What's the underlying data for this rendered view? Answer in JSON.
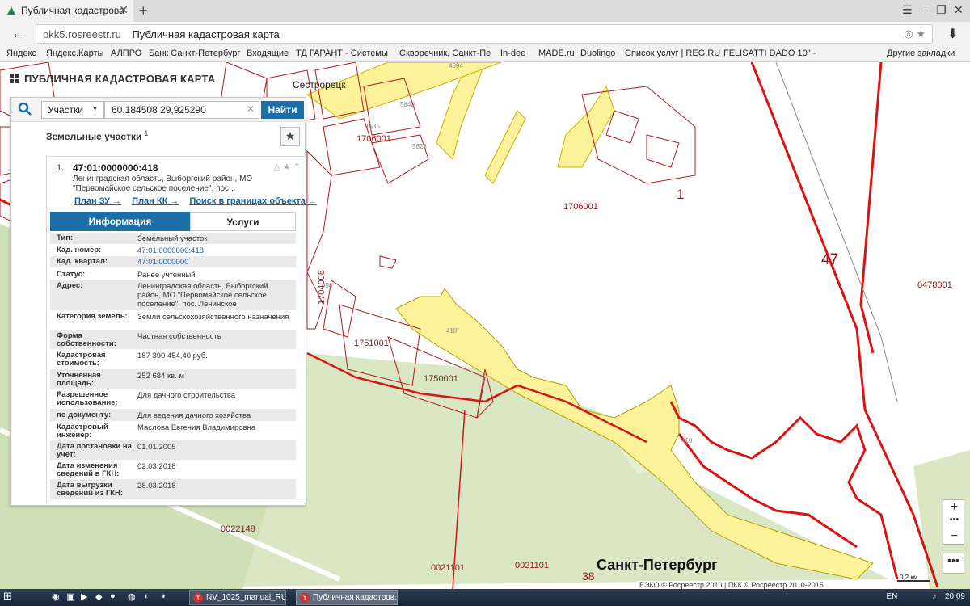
{
  "browser": {
    "tab_title": "Публичная кадастрова",
    "url_domain": "pkk5.rosreestr.ru",
    "page_title": "Публичная кадастровая карта",
    "bookmarks": [
      "Яндекс",
      "Яндекс.Карты",
      "АЛПРО",
      "Банк Санкт-Петербург",
      "Входящие",
      "ТД ГАРАНТ - Системы",
      "Скворечник, Санкт-Пе",
      "In-dee",
      "MADE.ru",
      "Duolingo",
      "Список услуг | REG.RU",
      "FELISATTI DADO 10\" -"
    ],
    "other_bookmarks": "Другие закладки"
  },
  "app": {
    "title": "ПУБЛИЧНАЯ КАДАСТРОВАЯ КАРТА"
  },
  "search": {
    "type": "Участки",
    "query": "60,184508 29,925290",
    "button": "Найти"
  },
  "results": {
    "header": "Земельные участки",
    "count": "1",
    "item_index": "1.",
    "cad_number": "47:01:0000000:418",
    "address_lines": [
      "Ленинградская область, Выборгский район, МО",
      "\"Первомайское сельское поселение\", пос..."
    ],
    "links": [
      "План ЗУ →",
      "План КК →",
      "Поиск в границах объекта →"
    ],
    "tab_info": "Информация",
    "tab_services": "Услуги",
    "rows": [
      {
        "k": "Тип:",
        "v": "Земельный участок"
      },
      {
        "k": "Кад. номер:",
        "v": "47:01:0000000:418"
      },
      {
        "k": "Кад. квартал:",
        "v": "47:01:0000000"
      },
      {
        "k": "Статус:",
        "v": "Ранее учтенный"
      },
      {
        "k": "Адрес:",
        "v": "Ленинградская область, Выборгский район, МО \"Первомайское сельское поселение\", пос. Ленинское"
      },
      {
        "k": "Категория земель:",
        "v": "Земли сельскохозяйственного назначения"
      },
      {
        "k": "Форма собственности:",
        "v": "Частная собственность"
      },
      {
        "k": "Кадастровая стоимость:",
        "v": "187 390 454,40 руб."
      },
      {
        "k": "Уточненная площадь:",
        "v": "252 684 кв. м"
      },
      {
        "k": "Разрешенное использование:",
        "v": "Для дачного строительства"
      },
      {
        "k": "по документу:",
        "v": "Для ведения дачного хозяйства"
      },
      {
        "k": "Кадастровый инженер:",
        "v": "Маслова Евгения Владимировна"
      },
      {
        "k": "Дата постановки на учет:",
        "v": "01.01.2005"
      },
      {
        "k": "Дата изменения сведений в ГКН:",
        "v": "02.03.2018"
      },
      {
        "k": "Дата выгрузки сведений из ГКН:",
        "v": "28.03.2018"
      }
    ]
  },
  "map": {
    "labels": {
      "town": "Сестрорецк",
      "city": "Санкт-Петербург",
      "q1706001": "1706001",
      "q1706001b": "1706001",
      "n1": "1",
      "n47": "47",
      "q0478001": "0478001",
      "q1751001": "1751001",
      "q1750001": "1750001",
      "q1704008": "1704008",
      "q0022148": "0022148",
      "q0021101a": "0021101",
      "q0021101b": "0021101",
      "n38": "38",
      "p418a": "418",
      "p418b": "418",
      "n4694": "4694",
      "n5840": "5840",
      "n1535": "1535",
      "n5828": "5828",
      "n4449": "4449",
      "n998": "998"
    },
    "copyright": "ЕЭКО © Росреестр 2010 | ПКК © Росреестр 2010-2015",
    "scale": "0,2 км"
  },
  "taskbar": {
    "tasks": [
      "NV_1025_manual_RU...",
      "Публичная кадастров..."
    ],
    "lang": "EN",
    "time": "20:09"
  }
}
